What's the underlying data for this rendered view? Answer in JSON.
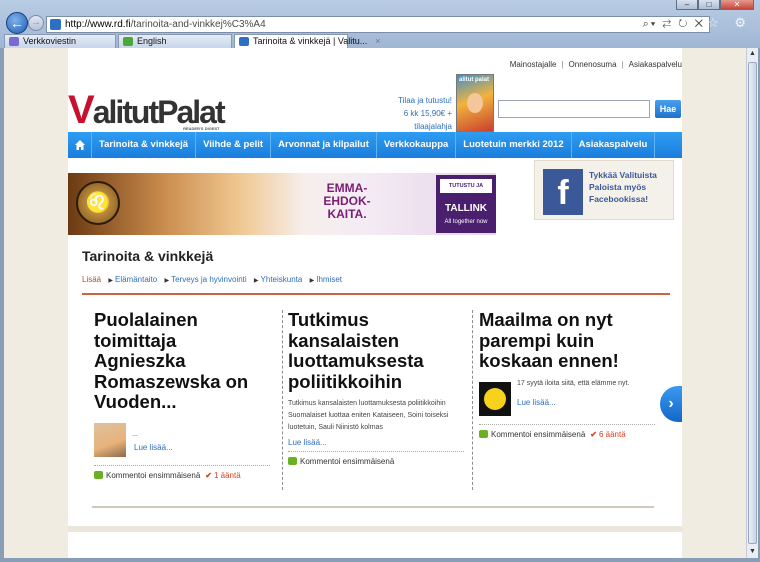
{
  "browser": {
    "address_domain": "http://www.rd.fi",
    "address_path": "/tarinoita-and-vinkkej%C3%A4",
    "tabs": [
      {
        "label": "Verkkoviestin"
      },
      {
        "label": "English"
      },
      {
        "label": "Tarinoita & vinkkejä | Valitu..."
      }
    ]
  },
  "header": {
    "top_links": [
      "Mainostajalle",
      "Onnenosuma",
      "Asiakaspalvelu"
    ],
    "logo_text": "alitutPalat",
    "logo_v": "V",
    "logo_sub": "READER'S DIGEST",
    "promo_line1": "Tilaa ja tutustu!",
    "promo_line2": "6 kk 15,90€ + tilaajalahja",
    "magazine_title": "alitut palat",
    "search_placeholder": "",
    "search_button": "Hae"
  },
  "nav": {
    "items": [
      "Tarinoita & vinkkejä",
      "Viihde & pelit",
      "Arvonnat ja kilpailut",
      "Verkkokauppa",
      "Luotetuin merkki 2012",
      "Asiakaspalvelu"
    ]
  },
  "banner": {
    "emma_text": "EMMA-EHDOK-KAITA.",
    "cta": "TUTUSTU JA VARAA »",
    "brand": "TALLINK",
    "tagline": "All together now"
  },
  "facebook": {
    "glyph": "f",
    "text": "Tykkää Valituista Paloista myös Facebookissa!"
  },
  "main": {
    "title": "Tarinoita & vinkkejä",
    "breadcrumb_lead": "Lisää",
    "breadcrumbs": [
      "Elämäntaito",
      "Terveys ja hyvinvointi",
      "Yhteiskunta",
      "Ihmiset"
    ],
    "articles": [
      {
        "title": "Puolalainen toimittaja Agnieszka Romaszewska on Vuoden...",
        "excerpt": "...",
        "more": "Lue lisää...",
        "comment": "Kommentoi ensimmäisenä",
        "votes": "1 ääntä"
      },
      {
        "title": "Tutkimus kansalaisten luottamuksesta poliitikkoihin",
        "excerpt": "Tutkimus kansalaisten luottamuksesta poliitikkoihin Suomalaiset luottaa eniten Kataiseen, Soini toiseksi luotetuin, Sauli Niinistö kolmas",
        "more": "Lue lisää...",
        "comment": "Kommentoi ensimmäisenä",
        "votes": ""
      },
      {
        "title": "Maailma on nyt parempi kuin koskaan ennen!",
        "excerpt": "17 syytä iloita siitä, että elämme nyt.",
        "more": "Lue lisää...",
        "comment": "Kommentoi ensimmäisenä",
        "votes": "6 ääntä"
      }
    ]
  },
  "colors": {
    "accent_blue": "#1a7ddc",
    "red_line": "#c9643c",
    "link_blue": "#2f6fb8",
    "facebook_blue": "#3b5998"
  }
}
